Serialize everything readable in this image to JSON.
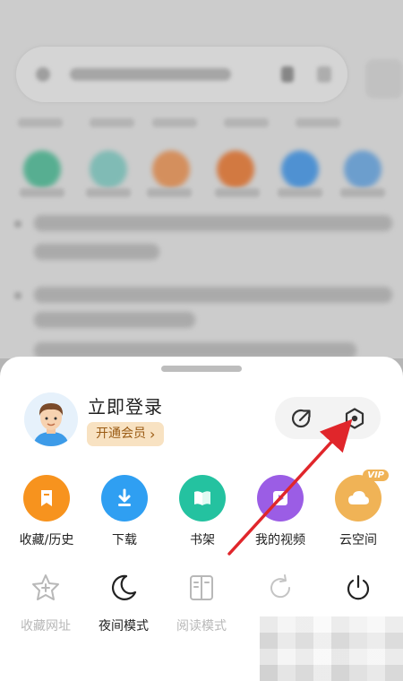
{
  "profile": {
    "login_label": "立即登录",
    "vip_label": "开通会员",
    "vip_chevron": "›"
  },
  "header_actions": [
    {
      "icon": "share-export-icon"
    },
    {
      "icon": "settings-hexagon-icon"
    }
  ],
  "grid_items": [
    {
      "label": "收藏/历史",
      "icon": "bookmark-icon",
      "color": "#f7931e"
    },
    {
      "label": "下载",
      "icon": "download-icon",
      "color": "#2f9ff2"
    },
    {
      "label": "书架",
      "icon": "book-icon",
      "color": "#24c2a0"
    },
    {
      "label": "我的视频",
      "icon": "play-icon",
      "color": "#9b5de5"
    },
    {
      "label": "云空间",
      "icon": "cloud-icon",
      "color": "#f0b356",
      "badge": "VIP"
    }
  ],
  "tools": [
    {
      "label": "收藏网址",
      "icon": "star-add-icon",
      "enabled": false
    },
    {
      "label": "夜间模式",
      "icon": "moon-icon",
      "enabled": true
    },
    {
      "label": "阅读模式",
      "icon": "reader-icon",
      "enabled": false
    },
    {
      "label": "",
      "icon": "refresh-icon",
      "enabled": false
    },
    {
      "label": "",
      "icon": "power-icon",
      "enabled": true
    }
  ],
  "colors": {
    "annotation_arrow": "#e0262b",
    "vip_bg": "#f8e2c2",
    "vip_text": "#9a5b14"
  }
}
